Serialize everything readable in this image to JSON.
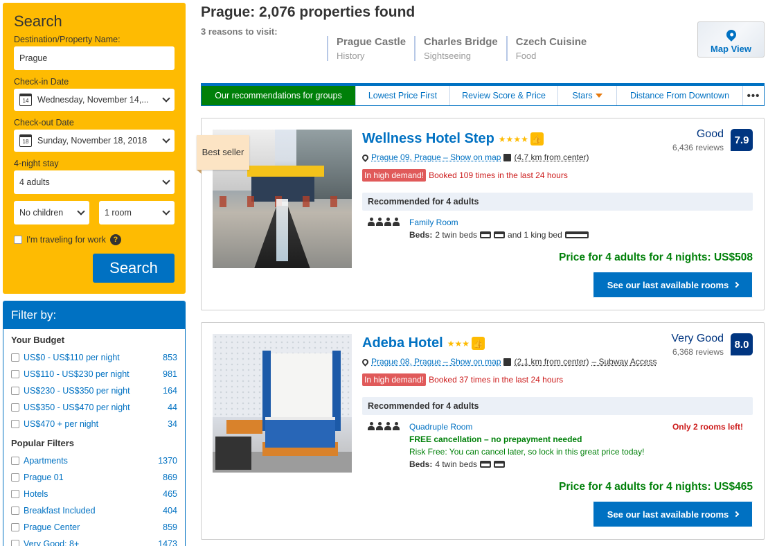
{
  "search": {
    "title": "Search",
    "destination_label": "Destination/Property Name:",
    "destination_value": "Prague",
    "checkin_label": "Check-in Date",
    "checkin_day": "14",
    "checkin_value": "Wednesday, November 14,...",
    "checkout_label": "Check-out Date",
    "checkout_day": "18",
    "checkout_value": "Sunday, November 18, 2018",
    "stay_label": "4-night stay",
    "adults_value": "4 adults",
    "children_value": "No children",
    "rooms_value": "1 room",
    "work_label": "I'm traveling for work",
    "help_glyph": "?",
    "button_label": "Search"
  },
  "filters": {
    "title": "Filter by:",
    "budget_title": "Your Budget",
    "budget": [
      {
        "label": "US$0 - US$110 per night",
        "count": "853"
      },
      {
        "label": "US$110 - US$230 per night",
        "count": "981"
      },
      {
        "label": "US$230 - US$350 per night",
        "count": "164"
      },
      {
        "label": "US$350 - US$470 per night",
        "count": "44"
      },
      {
        "label": "US$470 + per night",
        "count": "34"
      }
    ],
    "popular_title": "Popular Filters",
    "popular": [
      {
        "label": "Apartments",
        "count": "1370"
      },
      {
        "label": "Prague 01",
        "count": "869"
      },
      {
        "label": "Hotels",
        "count": "465"
      },
      {
        "label": "Breakfast Included",
        "count": "404"
      },
      {
        "label": "Prague Center",
        "count": "859"
      },
      {
        "label": "Very Good: 8+",
        "count": "1473"
      }
    ]
  },
  "header": {
    "title": "Prague: 2,076 properties found",
    "reasons_title": "3 reasons to visit:",
    "reasons": [
      {
        "name": "Prague Castle",
        "category": "History"
      },
      {
        "name": "Charles Bridge",
        "category": "Sightseeing"
      },
      {
        "name": "Czech Cuisine",
        "category": "Food"
      }
    ],
    "map_view": "Map View"
  },
  "sort": {
    "tabs": [
      "Our recommendations for groups",
      "Lowest Price First",
      "Review Score & Price",
      "Stars",
      "Distance From Downtown"
    ],
    "more": "•••"
  },
  "hotels": [
    {
      "badge": "Best seller",
      "name": "Wellness Hotel Step",
      "stars": "★★★★",
      "location": "Prague 09, Prague – Show on map",
      "distance": "(4.7 km from center)",
      "demand_badge": "In high demand!",
      "demand_text": "Booked 109 times in the last 24 hours",
      "recommended": "Recommended for 4 adults",
      "room_name": "Family Room",
      "beds_label": "Beds:",
      "beds_text_1": "2 twin beds",
      "beds_text_2": "and 1 king bed",
      "price": "Price for 4 adults for 4 nights: US$508",
      "button": "See our last available rooms",
      "score_word": "Good",
      "reviews": "6,436 reviews",
      "score": "7.9"
    },
    {
      "name": "Adeba Hotel",
      "stars": "★★★",
      "location": "Prague 08, Prague – Show on map",
      "distance": "(2.1 km from center)",
      "subway": "– Subway Access",
      "demand_badge": "In high demand!",
      "demand_text": "Booked 37 times in the last 24 hours",
      "recommended": "Recommended for 4 adults",
      "room_name": "Quadruple Room",
      "free_cancel": "FREE cancellation – no prepayment needed",
      "risk_free": "Risk Free: You can cancel later, so lock in this great price today!",
      "beds_label": "Beds:",
      "beds_text_1": "4 twin beds",
      "rooms_left": "Only 2 rooms left!",
      "price": "Price for 4 adults for 4 nights: US$465",
      "button": "See our last available rooms",
      "score_word": "Very Good",
      "reviews": "6,368 reviews",
      "score": "8.0"
    }
  ],
  "colors": {
    "brand_blue": "#0071c2",
    "search_yellow": "#febb02",
    "active_green": "#008009",
    "score_navy": "#003580",
    "demand_red": "#cc1b1b"
  },
  "icons": [
    "calendar-icon",
    "chevron-down-icon",
    "help-icon",
    "map-pin-icon",
    "thumbs-up-icon",
    "person-icon",
    "bed-icon",
    "chevron-right-icon"
  ]
}
